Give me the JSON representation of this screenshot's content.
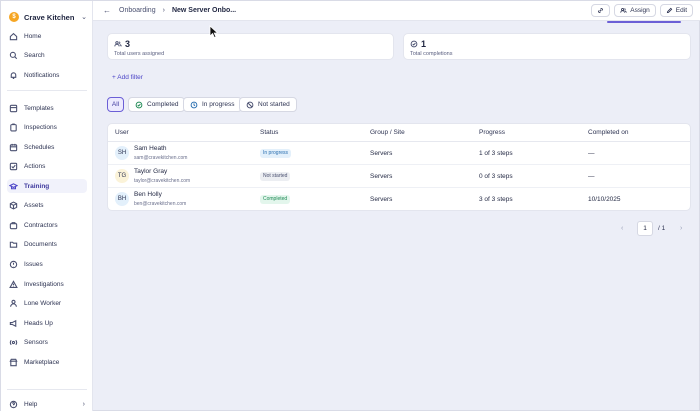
{
  "org": {
    "name": "Crave Kitchen",
    "logo_letter": "$"
  },
  "sidebar": {
    "items": [
      {
        "label": "Home",
        "icon": "home-icon"
      },
      {
        "label": "Search",
        "icon": "search-icon"
      },
      {
        "label": "Notifications",
        "icon": "bell-icon"
      },
      {
        "label": "Templates",
        "icon": "template-icon"
      },
      {
        "label": "Inspections",
        "icon": "clipboard-icon"
      },
      {
        "label": "Schedules",
        "icon": "calendar-icon"
      },
      {
        "label": "Actions",
        "icon": "actions-icon"
      },
      {
        "label": "Training",
        "icon": "training-icon"
      },
      {
        "label": "Assets",
        "icon": "cube-icon"
      },
      {
        "label": "Contractors",
        "icon": "contractor-icon"
      },
      {
        "label": "Documents",
        "icon": "folder-icon"
      },
      {
        "label": "Issues",
        "icon": "issue-icon"
      },
      {
        "label": "Investigations",
        "icon": "warning-icon"
      },
      {
        "label": "Lone Worker",
        "icon": "person-icon"
      },
      {
        "label": "Heads Up",
        "icon": "megaphone-icon"
      },
      {
        "label": "Sensors",
        "icon": "sensor-icon"
      },
      {
        "label": "Marketplace",
        "icon": "store-icon"
      }
    ],
    "active": "Training",
    "help_label": "Help"
  },
  "header": {
    "breadcrumb_parent": "Onboarding",
    "breadcrumb_current": "New Server Onbo...",
    "assign_label": "Assign",
    "edit_label": "Edit"
  },
  "summary": {
    "users_assigned_count": "3",
    "users_assigned_label": "Total users assigned",
    "completions_count": "1",
    "completions_label": "Total completions"
  },
  "add_filter_label": "Add filter",
  "filters": {
    "all": "All",
    "completed": "Completed",
    "in_progress": "In progress",
    "not_started": "Not started",
    "active": "All"
  },
  "table": {
    "headers": {
      "user": "User",
      "status": "Status",
      "group": "Group / Site",
      "progress": "Progress",
      "completed_on": "Completed on"
    },
    "rows": [
      {
        "initials": "SH",
        "name": "Sam Heath",
        "email": "sam@cravekitchen.com",
        "status": "In progress",
        "group": "Servers",
        "progress": "1 of 3 steps",
        "completed_on": "—"
      },
      {
        "initials": "TG",
        "name": "Taylor Gray",
        "email": "taylor@cravekitchen.com",
        "status": "Not started",
        "group": "Servers",
        "progress": "0 of 3 steps",
        "completed_on": "—"
      },
      {
        "initials": "BH",
        "name": "Ben Holly",
        "email": "ben@cravekitchen.com",
        "status": "Completed",
        "group": "Servers",
        "progress": "3 of 3 steps",
        "completed_on": "10/10/2025"
      }
    ]
  },
  "pagination": {
    "current_page": "1",
    "of_label": "/ 1"
  },
  "colors": {
    "accent": "#6b5fd6",
    "status_in_progress_bg": "#e3f0fb",
    "status_in_progress_text": "#2a6fb0",
    "status_not_started_bg": "#eceef2",
    "status_not_started_text": "#4a5070",
    "status_completed_bg": "#e3f6ec",
    "status_completed_text": "#1f8a55"
  }
}
